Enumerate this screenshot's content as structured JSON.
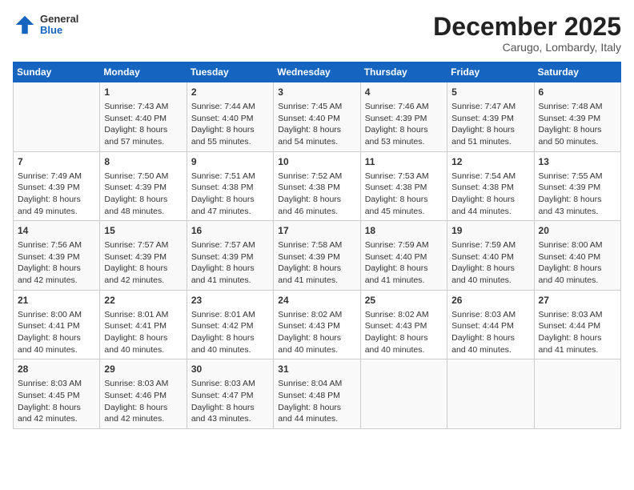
{
  "header": {
    "logo_general": "General",
    "logo_blue": "Blue",
    "month": "December 2025",
    "location": "Carugo, Lombardy, Italy"
  },
  "days_of_week": [
    "Sunday",
    "Monday",
    "Tuesday",
    "Wednesday",
    "Thursday",
    "Friday",
    "Saturday"
  ],
  "weeks": [
    [
      {
        "day": "",
        "info": ""
      },
      {
        "day": "1",
        "info": "Sunrise: 7:43 AM\nSunset: 4:40 PM\nDaylight: 8 hours\nand 57 minutes."
      },
      {
        "day": "2",
        "info": "Sunrise: 7:44 AM\nSunset: 4:40 PM\nDaylight: 8 hours\nand 55 minutes."
      },
      {
        "day": "3",
        "info": "Sunrise: 7:45 AM\nSunset: 4:40 PM\nDaylight: 8 hours\nand 54 minutes."
      },
      {
        "day": "4",
        "info": "Sunrise: 7:46 AM\nSunset: 4:39 PM\nDaylight: 8 hours\nand 53 minutes."
      },
      {
        "day": "5",
        "info": "Sunrise: 7:47 AM\nSunset: 4:39 PM\nDaylight: 8 hours\nand 51 minutes."
      },
      {
        "day": "6",
        "info": "Sunrise: 7:48 AM\nSunset: 4:39 PM\nDaylight: 8 hours\nand 50 minutes."
      }
    ],
    [
      {
        "day": "7",
        "info": "Sunrise: 7:49 AM\nSunset: 4:39 PM\nDaylight: 8 hours\nand 49 minutes."
      },
      {
        "day": "8",
        "info": "Sunrise: 7:50 AM\nSunset: 4:39 PM\nDaylight: 8 hours\nand 48 minutes."
      },
      {
        "day": "9",
        "info": "Sunrise: 7:51 AM\nSunset: 4:38 PM\nDaylight: 8 hours\nand 47 minutes."
      },
      {
        "day": "10",
        "info": "Sunrise: 7:52 AM\nSunset: 4:38 PM\nDaylight: 8 hours\nand 46 minutes."
      },
      {
        "day": "11",
        "info": "Sunrise: 7:53 AM\nSunset: 4:38 PM\nDaylight: 8 hours\nand 45 minutes."
      },
      {
        "day": "12",
        "info": "Sunrise: 7:54 AM\nSunset: 4:38 PM\nDaylight: 8 hours\nand 44 minutes."
      },
      {
        "day": "13",
        "info": "Sunrise: 7:55 AM\nSunset: 4:39 PM\nDaylight: 8 hours\nand 43 minutes."
      }
    ],
    [
      {
        "day": "14",
        "info": "Sunrise: 7:56 AM\nSunset: 4:39 PM\nDaylight: 8 hours\nand 42 minutes."
      },
      {
        "day": "15",
        "info": "Sunrise: 7:57 AM\nSunset: 4:39 PM\nDaylight: 8 hours\nand 42 minutes."
      },
      {
        "day": "16",
        "info": "Sunrise: 7:57 AM\nSunset: 4:39 PM\nDaylight: 8 hours\nand 41 minutes."
      },
      {
        "day": "17",
        "info": "Sunrise: 7:58 AM\nSunset: 4:39 PM\nDaylight: 8 hours\nand 41 minutes."
      },
      {
        "day": "18",
        "info": "Sunrise: 7:59 AM\nSunset: 4:40 PM\nDaylight: 8 hours\nand 41 minutes."
      },
      {
        "day": "19",
        "info": "Sunrise: 7:59 AM\nSunset: 4:40 PM\nDaylight: 8 hours\nand 40 minutes."
      },
      {
        "day": "20",
        "info": "Sunrise: 8:00 AM\nSunset: 4:40 PM\nDaylight: 8 hours\nand 40 minutes."
      }
    ],
    [
      {
        "day": "21",
        "info": "Sunrise: 8:00 AM\nSunset: 4:41 PM\nDaylight: 8 hours\nand 40 minutes."
      },
      {
        "day": "22",
        "info": "Sunrise: 8:01 AM\nSunset: 4:41 PM\nDaylight: 8 hours\nand 40 minutes."
      },
      {
        "day": "23",
        "info": "Sunrise: 8:01 AM\nSunset: 4:42 PM\nDaylight: 8 hours\nand 40 minutes."
      },
      {
        "day": "24",
        "info": "Sunrise: 8:02 AM\nSunset: 4:43 PM\nDaylight: 8 hours\nand 40 minutes."
      },
      {
        "day": "25",
        "info": "Sunrise: 8:02 AM\nSunset: 4:43 PM\nDaylight: 8 hours\nand 40 minutes."
      },
      {
        "day": "26",
        "info": "Sunrise: 8:03 AM\nSunset: 4:44 PM\nDaylight: 8 hours\nand 40 minutes."
      },
      {
        "day": "27",
        "info": "Sunrise: 8:03 AM\nSunset: 4:44 PM\nDaylight: 8 hours\nand 41 minutes."
      }
    ],
    [
      {
        "day": "28",
        "info": "Sunrise: 8:03 AM\nSunset: 4:45 PM\nDaylight: 8 hours\nand 42 minutes."
      },
      {
        "day": "29",
        "info": "Sunrise: 8:03 AM\nSunset: 4:46 PM\nDaylight: 8 hours\nand 42 minutes."
      },
      {
        "day": "30",
        "info": "Sunrise: 8:03 AM\nSunset: 4:47 PM\nDaylight: 8 hours\nand 43 minutes."
      },
      {
        "day": "31",
        "info": "Sunrise: 8:04 AM\nSunset: 4:48 PM\nDaylight: 8 hours\nand 44 minutes."
      },
      {
        "day": "",
        "info": ""
      },
      {
        "day": "",
        "info": ""
      },
      {
        "day": "",
        "info": ""
      }
    ]
  ]
}
